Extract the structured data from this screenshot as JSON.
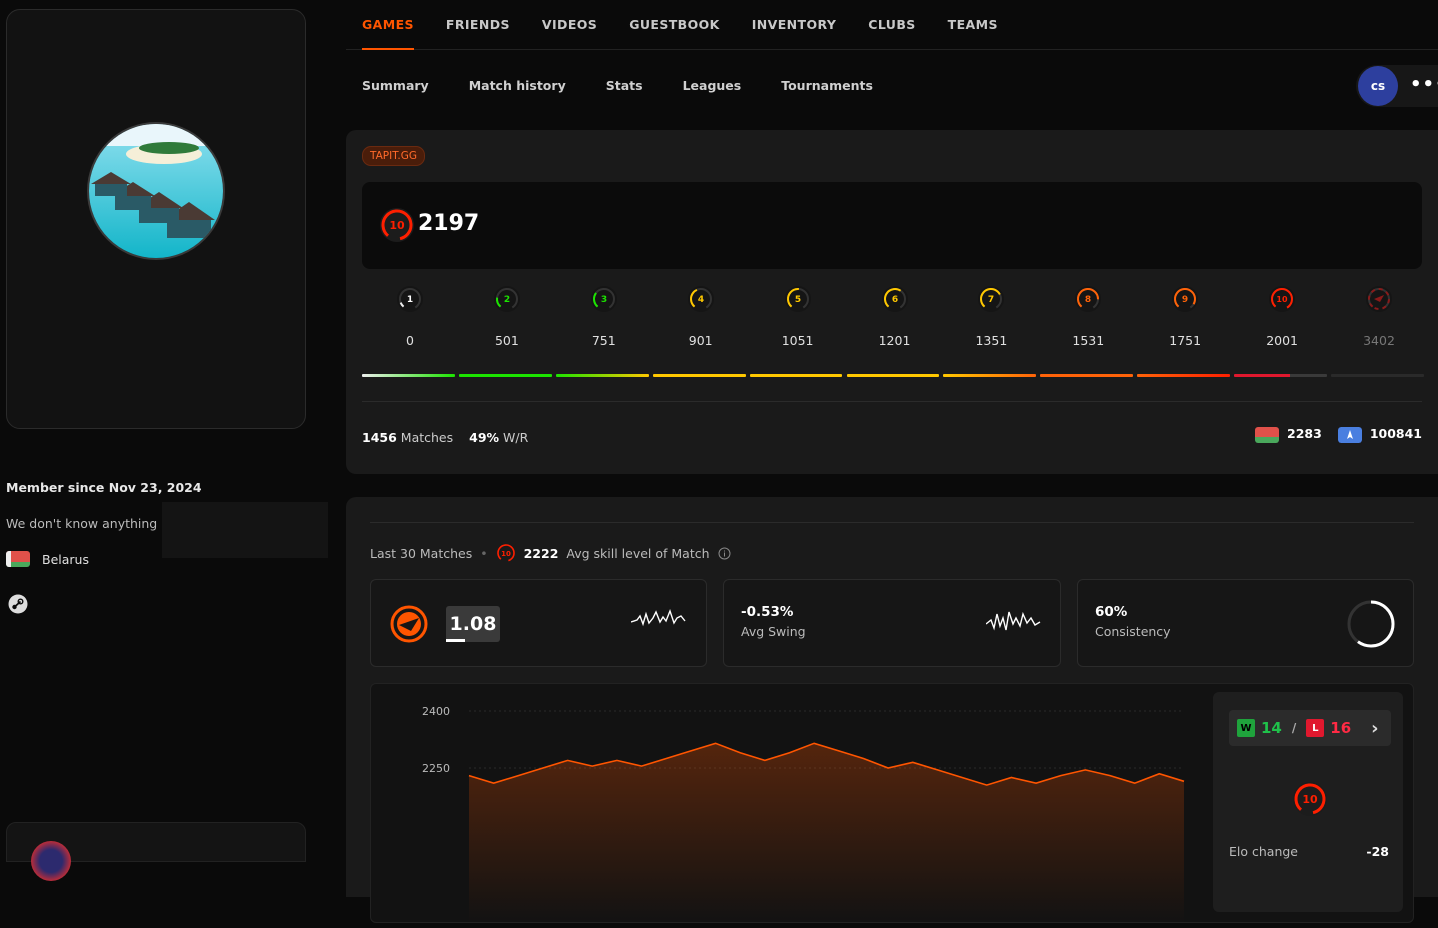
{
  "sidebar": {
    "member_since": "Member since Nov 23, 2024",
    "bio": "We don't know anything",
    "country": "Belarus"
  },
  "tabs": [
    "GAMES",
    "FRIENDS",
    "VIDEOS",
    "GUESTBOOK",
    "INVENTORY",
    "CLUBS",
    "TEAMS"
  ],
  "subtabs": [
    "Summary",
    "Match history",
    "Stats",
    "Leagues",
    "Tournaments"
  ],
  "game": {
    "logo": "cs",
    "more": "•••"
  },
  "elo": {
    "badge": "TAPIT.GG",
    "current_level": "10",
    "value": "2197",
    "levels": [
      {
        "level": "1",
        "min": "0",
        "color": "#eeeeee"
      },
      {
        "level": "2",
        "min": "501",
        "color": "#1ce400"
      },
      {
        "level": "3",
        "min": "751",
        "color": "#1ce400"
      },
      {
        "level": "4",
        "min": "901",
        "color": "#ffc800"
      },
      {
        "level": "5",
        "min": "1051",
        "color": "#ffc800"
      },
      {
        "level": "6",
        "min": "1201",
        "color": "#ffc800"
      },
      {
        "level": "7",
        "min": "1351",
        "color": "#ffc800"
      },
      {
        "level": "8",
        "min": "1531",
        "color": "#ff6309"
      },
      {
        "level": "9",
        "min": "1751",
        "color": "#ff6309"
      },
      {
        "level": "10",
        "min": "2001",
        "color": "#fe1f00"
      },
      {
        "level": "",
        "min": "3402",
        "color": "#8a1a1a"
      }
    ],
    "progress_in_level": 0.6
  },
  "stats": {
    "matches_num": "1456",
    "matches_label": "Matches",
    "winrate_num": "49%",
    "winrate_label": "W/R",
    "country_rank": "2283",
    "region_rank": "100841"
  },
  "last30": {
    "title": "Last 30 Matches",
    "avg_level": "10",
    "avg_value": "2222",
    "avg_label": "Avg skill level of Match",
    "rating": "1.08",
    "rating_fill": 0.35,
    "avg_swing": "-0.53%",
    "avg_swing_label": "Avg Swing",
    "consistency": "60%",
    "consistency_label": "Consistency",
    "consistency_fraction": 0.6
  },
  "chart_data": {
    "type": "area",
    "y_ticks": [
      "2400",
      "2250"
    ],
    "ylim": [
      2100,
      2425
    ],
    "values": [
      2230,
      2210,
      2230,
      2250,
      2270,
      2255,
      2270,
      2255,
      2275,
      2295,
      2315,
      2290,
      2270,
      2290,
      2315,
      2295,
      2275,
      2250,
      2265,
      2245,
      2225,
      2205,
      2225,
      2210,
      2230,
      2245,
      2230,
      2210,
      2235,
      2215
    ]
  },
  "summary": {
    "wins": "14",
    "losses": "16",
    "w_letter": "W",
    "l_letter": "L",
    "sep": "/",
    "chev": "›",
    "level": "10",
    "elo_change_label": "Elo change",
    "elo_change_value": "-28"
  }
}
